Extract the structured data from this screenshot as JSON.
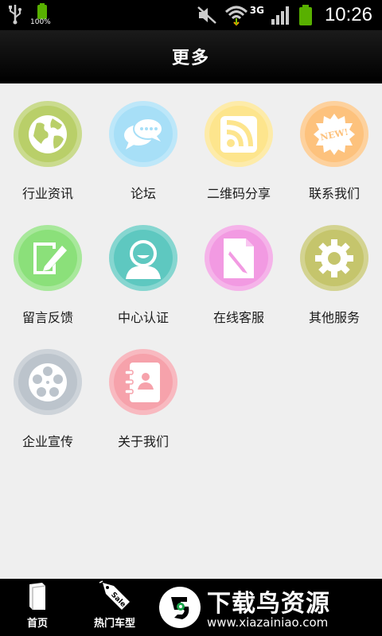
{
  "status_bar": {
    "battery_percent": "100%",
    "network": "3G",
    "time": "10:26"
  },
  "header": {
    "title": "更多"
  },
  "menu": {
    "items": [
      {
        "label": "行业资讯",
        "icon": "globe-icon",
        "color": "#b9cf69"
      },
      {
        "label": "论坛",
        "icon": "chat-bubbles-icon",
        "color": "#a7dff7"
      },
      {
        "label": "二维码分享",
        "icon": "rss-icon",
        "color": "#fde58d"
      },
      {
        "label": "联系我们",
        "icon": "new-badge-icon",
        "color": "#fdc27d"
      },
      {
        "label": "留言反馈",
        "icon": "edit-pen-icon",
        "color": "#8be07a"
      },
      {
        "label": "中心认证",
        "icon": "user-avatar-icon",
        "color": "#5ec8c0"
      },
      {
        "label": "在线客服",
        "icon": "document-pen-icon",
        "color": "#f29ae2"
      },
      {
        "label": "其他服务",
        "icon": "gear-icon",
        "color": "#c5c56c"
      },
      {
        "label": "企业宣传",
        "icon": "film-reel-icon",
        "color": "#bcc4cc"
      },
      {
        "label": "关于我们",
        "icon": "contacts-book-icon",
        "color": "#f6a2ab"
      }
    ]
  },
  "bottom_bar": {
    "tabs": [
      {
        "label": "首页",
        "icon": "book-icon"
      },
      {
        "label": "热门车型",
        "icon": "sale-tag-icon",
        "tag_text": "Sale"
      }
    ],
    "brand": {
      "name": "下载鸟资源",
      "url": "www.xiazainiao.com"
    }
  }
}
